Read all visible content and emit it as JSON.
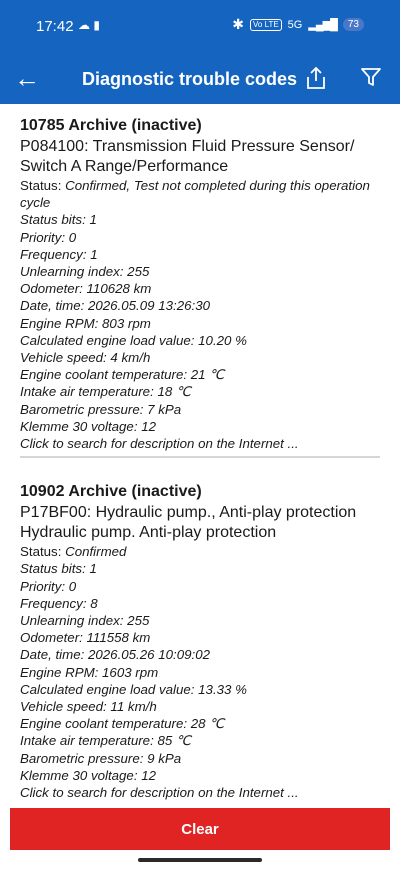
{
  "status_bar": {
    "time": "17:42",
    "left_icons": "☁ ▮",
    "bluetooth_icon": "✱",
    "volte_badge": "Vo LTE",
    "signal_label": "5G",
    "signal_bars": "▂▄▆█",
    "battery_level": "73"
  },
  "app_bar": {
    "title": "Diagnostic trouble codes",
    "back_glyph": "←"
  },
  "records": [
    {
      "heading": "10785 Archive (inactive)",
      "code_description": "P084100: Transmission Fluid Pressure Sensor/ Switch A Range/Performance",
      "status_label": "Status: ",
      "status_value": "Confirmed, Test not completed during this operation cycle",
      "fields": [
        "Status bits: 1",
        "Priority: 0",
        "Frequency: 1",
        "Unlearning index: 255",
        "Odometer: 110628 km",
        "Date, time: 2026.05.09 13:26:30",
        "Engine RPM: 803 rpm",
        "Calculated engine load value: 10.20 %",
        "Vehicle speed: 4 km/h",
        "Engine coolant temperature: 21 ℃",
        "Intake air temperature: 18 ℃",
        "Barometric pressure: 7 kPa",
        "Klemme 30 voltage: 12"
      ],
      "search_link": "Click to search for description on the Internet ..."
    },
    {
      "heading": "10902 Archive (inactive)",
      "code_description": "P17BF00: Hydraulic pump., Anti-play protection Hydraulic pump. Anti-play protection",
      "status_label": "Status: ",
      "status_value": "Confirmed",
      "fields": [
        "Status bits: 1",
        "Priority: 0",
        "Frequency: 8",
        "Unlearning index: 255",
        "Odometer: 111558 km",
        "Date, time: 2026.05.26 10:09:02",
        "Engine RPM: 1603 rpm",
        "Calculated engine load value: 13.33 %",
        "Vehicle speed: 11 km/h",
        "Engine coolant temperature: 28 ℃",
        "Intake air temperature: 85 ℃",
        "Barometric pressure: 9 kPa",
        "Klemme 30 voltage: 12"
      ],
      "search_link": "Click to search for description on the Internet ..."
    }
  ],
  "clear_button_label": "Clear",
  "colors": {
    "primary": "#1565c0",
    "clear_button": "#e02424"
  }
}
